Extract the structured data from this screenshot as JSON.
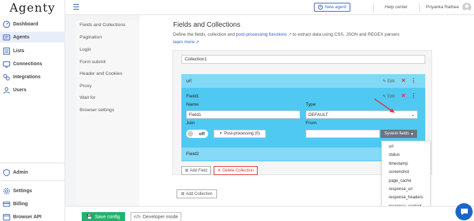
{
  "app": {
    "logo": "Agenty"
  },
  "sidebar": {
    "items": [
      {
        "label": "Dashboard",
        "icon": "dashboard-icon"
      },
      {
        "label": "Agents",
        "icon": "agents-icon"
      },
      {
        "label": "Lists",
        "icon": "lists-icon"
      },
      {
        "label": "Connections",
        "icon": "connections-icon"
      },
      {
        "label": "Integrations",
        "icon": "integrations-icon"
      },
      {
        "label": "Users",
        "icon": "users-icon"
      }
    ],
    "bottom_items": [
      {
        "label": "Admin",
        "icon": "admin-icon"
      },
      {
        "label": "Settings",
        "icon": "settings-icon"
      },
      {
        "label": "Billing",
        "icon": "billing-icon"
      },
      {
        "label": "Browser API",
        "icon": "browser-api-icon"
      }
    ],
    "active_color": "#e8eef9"
  },
  "topbar": {
    "new_agent": "New agent",
    "help_center": "Help center",
    "user_name": "Priyanka Rathee"
  },
  "inner_menu": {
    "items": [
      "Fields and Collections",
      "Pagination",
      "Login",
      "Form submit",
      "Header and Cookies",
      "Proxy",
      "Wait for",
      "Browser settings"
    ]
  },
  "main": {
    "title": "Fields and Collections",
    "desc_prefix": "Define the fields, collection and ",
    "desc_link": "post-processing functions",
    "desc_suffix": " to extract data using CSS, JSON and REGEX parsers",
    "learn_more": "learn more",
    "collection_name": "Collection1",
    "url_label": "url",
    "edit_label": "Edit",
    "field1": {
      "title": "Field1",
      "name_label": "Name",
      "name_value": "Field1",
      "type_label": "Type",
      "type_value": "DEFAULT",
      "join_label": "Join",
      "join_value": "off",
      "from_label": "From",
      "from_value": "",
      "post_processing": "Post-processing (0)",
      "system_fields": "System fields"
    },
    "field2_title": "Field2",
    "add_field": "Add Field",
    "delete_collection": "Delete Collection",
    "add_collection": "Add Collection"
  },
  "system_fields_menu": [
    "url",
    "status",
    "timestamp",
    "screenshot",
    "page_cache",
    "response_uri",
    "response_headers",
    "response_content"
  ],
  "bottombar": {
    "save": "Save config",
    "developer": "Developer mode"
  },
  "colors": {
    "accent": "#3d63b8",
    "field_panel": "#4fc9f2",
    "url_bar": "#82d8f7",
    "save_green": "#21b36c",
    "danger": "#e03030",
    "chat": "#1a66c6"
  }
}
